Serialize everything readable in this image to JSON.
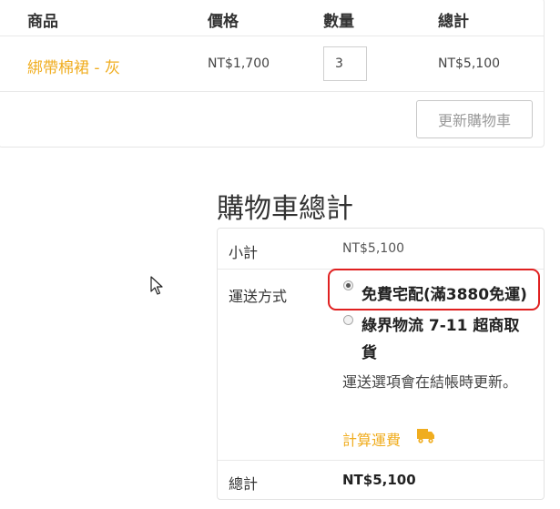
{
  "cart_table": {
    "headers": {
      "product": "商品",
      "price": "價格",
      "quantity": "數量",
      "total": "總計"
    },
    "item": {
      "product_name": "綁帶棉裙 - 灰",
      "price": "NT$1,700",
      "quantity": "3",
      "total": "NT$5,100"
    },
    "update_button": "更新購物車"
  },
  "cart_totals": {
    "title": "購物車總計",
    "subtotal_label": "小計",
    "subtotal_value": "NT$5,100",
    "shipping_label": "運送方式",
    "shipping_options": [
      {
        "label": "免費宅配(滿3880免運)",
        "selected": true
      },
      {
        "label": "綠界物流 7-11 超商取貨",
        "selected": false
      }
    ],
    "shipping_note": "運送選項會在結帳時更新。",
    "calculate_shipping": "計算運費",
    "total_label": "總計",
    "total_value": "NT$5,100"
  },
  "colors": {
    "accent": "#f0ad1f",
    "highlight": "#e02020"
  },
  "icons": {
    "calculate_shipping": "truck-icon",
    "pointer": "mouse-cursor-icon"
  }
}
